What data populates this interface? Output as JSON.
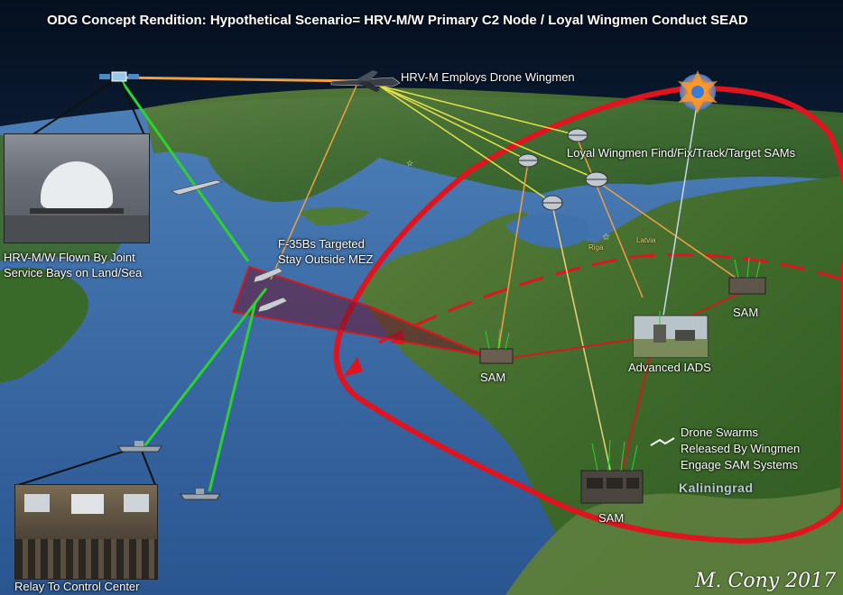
{
  "title": "ODG Concept Rendition: Hypothetical Scenario= HRV-M/W Primary C2 Node / Loyal Wingmen Conduct SEAD",
  "labels": {
    "hrv_employs": "HRV-M Employs Drone Wingmen",
    "loyal_wingmen": "Loyal Wingmen Find/Fix/Track/Target SAMs",
    "hrv_flown_line1": "HRV-M/W Flown By Joint",
    "hrv_flown_line2": "Service Bays on Land/Sea",
    "f35_line1": "F-35Bs Targeted",
    "f35_line2": "Stay Outside MEZ",
    "sam_1": "SAM",
    "sam_2": "SAM",
    "sam_3": "SAM",
    "advanced_iads": "Advanced IADS",
    "drone_line1": "Drone Swarms",
    "drone_line2": "Released By Wingmen",
    "drone_line3": "Engage SAM Systems",
    "kaliningrad": "Kaliningrad",
    "relay": "Relay To Control Center",
    "city_riga": "Riga",
    "city_latvia": "Latvia"
  },
  "signature": "M. Cony 2017",
  "colors": {
    "sea": "#2e5f9c",
    "land": "#3d6b2e",
    "mez_ring": "#e0141e",
    "datalink_green": "#2fd12f",
    "datalink_yellow": "#e8e04a",
    "datalink_orange": "#f0a040",
    "strike_red": "#d01a20",
    "f35_zone": "#6a1430"
  },
  "icons": [
    "satellite-icon",
    "hrv-aircraft-icon",
    "loyal-wingman-icon",
    "explosion-icon",
    "f35-jet-icon",
    "ship-icon",
    "sam-site-icon",
    "drone-swarm-icon"
  ]
}
